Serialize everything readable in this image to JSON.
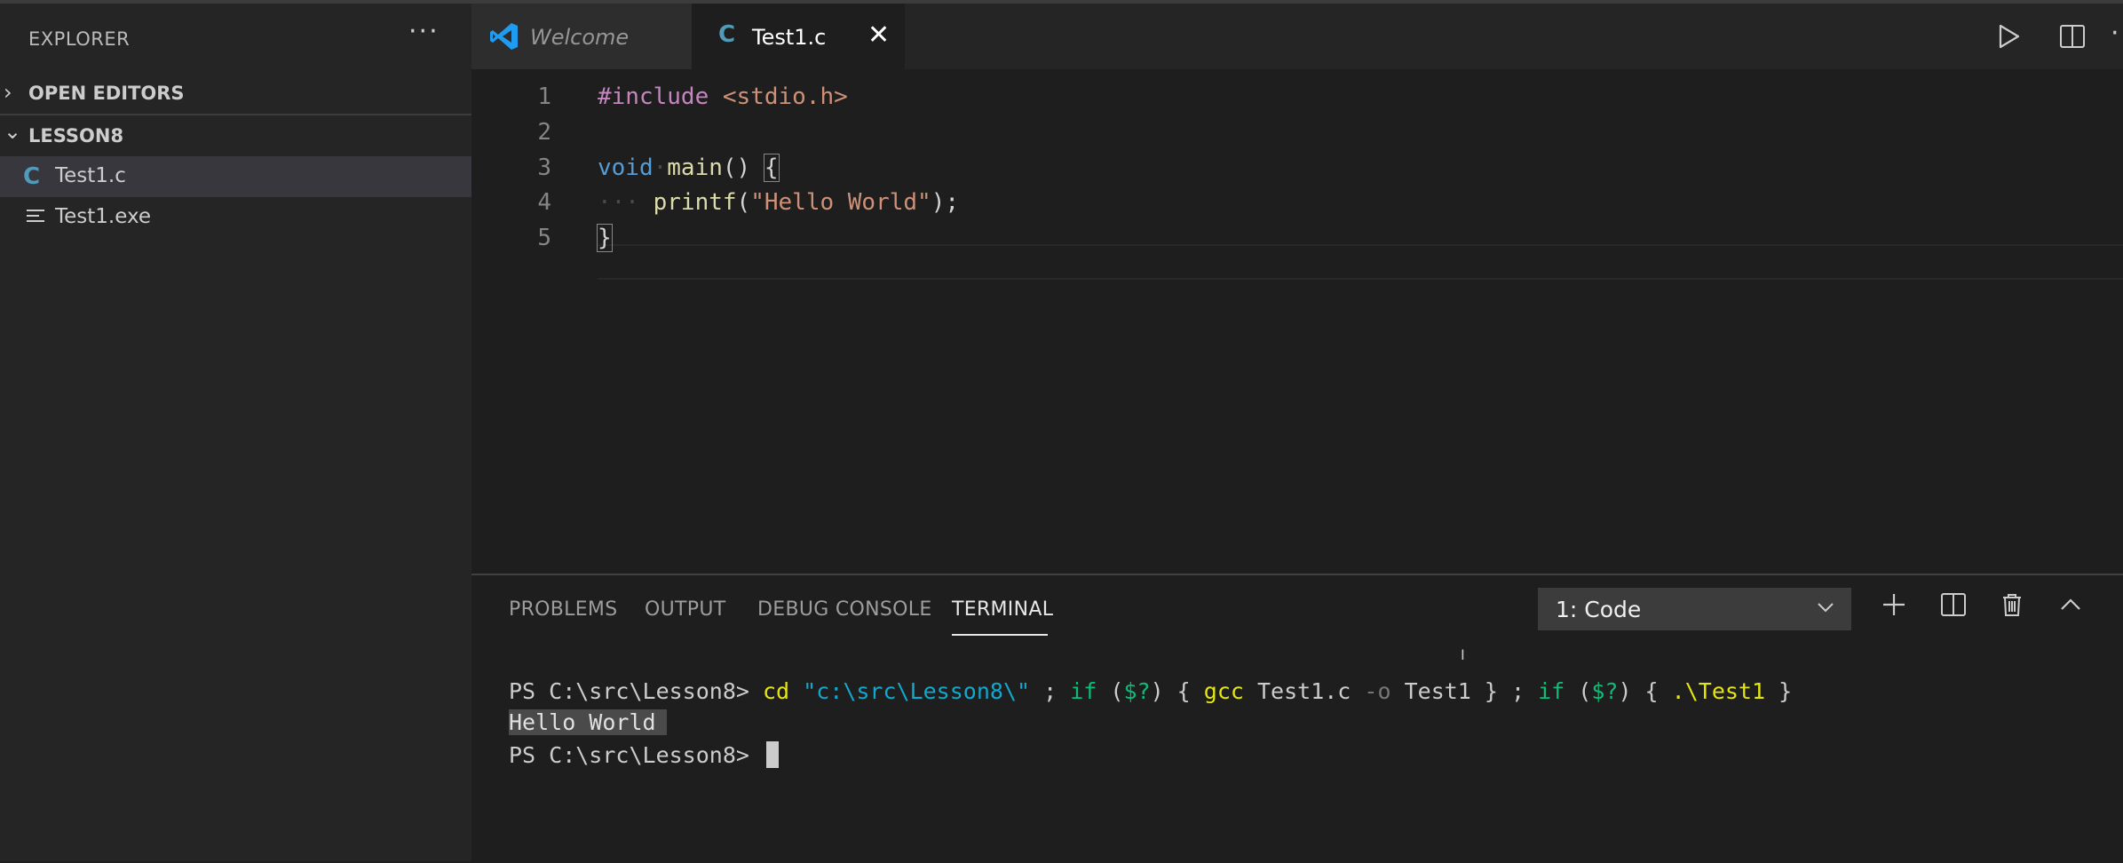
{
  "sidebar": {
    "title": "EXPLORER",
    "open_editors": "OPEN EDITORS",
    "folder": "LESSON8",
    "files": [
      {
        "name": "Test1.c",
        "icon": "c-file-icon"
      },
      {
        "name": "Test1.exe",
        "icon": "lines-file-icon"
      }
    ]
  },
  "tabs": [
    {
      "label": "Welcome",
      "icon": "vscode-icon"
    },
    {
      "label": "Test1.c",
      "icon": "c-file-icon"
    }
  ],
  "editor": {
    "line_numbers": [
      "1",
      "2",
      "3",
      "4",
      "5"
    ],
    "code": {
      "l1_directive": "#include",
      "l1_header": "<stdio.h>",
      "l3_type": "void",
      "l3_func": "main",
      "l3_rest": "() ",
      "l3_brace": "{",
      "l4_indent": "···",
      "l4_func": "printf",
      "l4_open": "(",
      "l4_str": "\"Hello World\"",
      "l4_close": ");",
      "l5_brace": "}"
    }
  },
  "panel": {
    "tabs": [
      "PROBLEMS",
      "OUTPUT",
      "DEBUG CONSOLE",
      "TERMINAL"
    ],
    "terminal_select": "1: Code",
    "terminal": {
      "prompt": "PS C:\\src\\Lesson8>",
      "cmd_cd": "cd",
      "cmd_path": "\"c:\\src\\Lesson8\\\"",
      "sep1": ";",
      "if1": "if",
      "cond1": "$?",
      "gcc": "gcc",
      "gcc_file": "Test1.c",
      "gcc_flag": "-o",
      "gcc_out": "Test1",
      "if2": "if",
      "cond2": "$?",
      "run": ".\\Test1",
      "output": "Hello World",
      "prompt2": "PS C:\\src\\Lesson8>"
    }
  },
  "colors": {
    "accent": "#007acc",
    "c_icon": "#519aba"
  }
}
